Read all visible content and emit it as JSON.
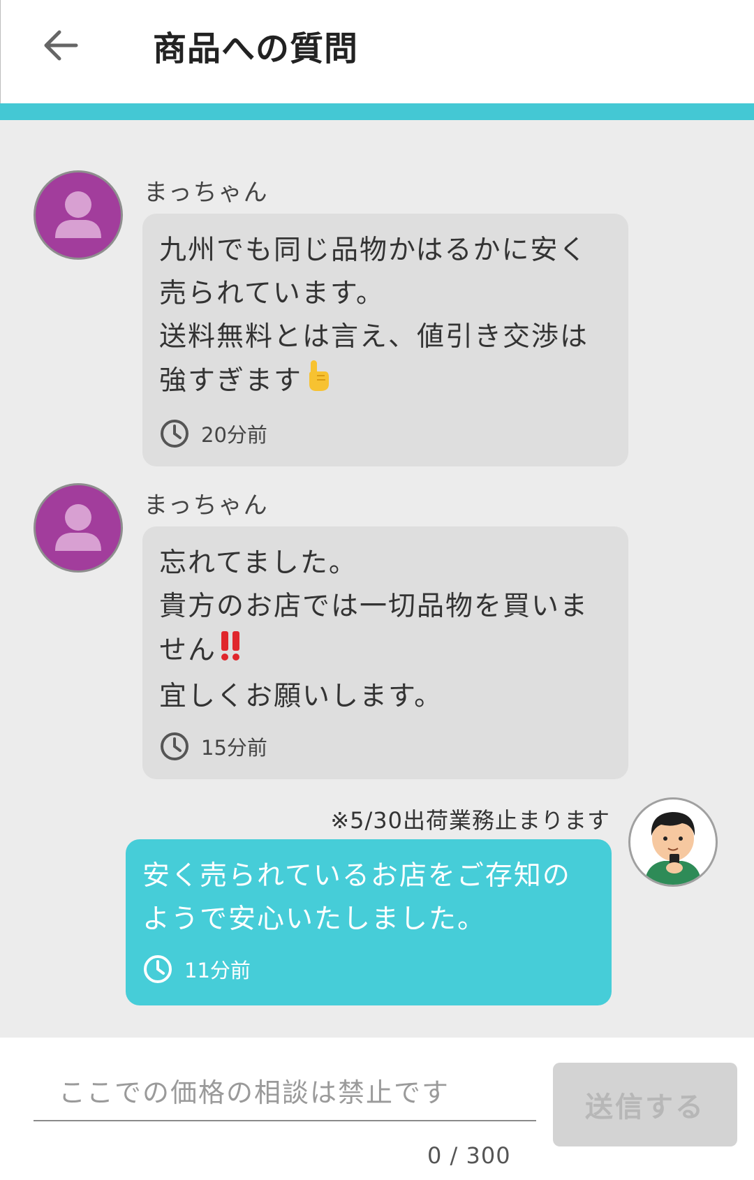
{
  "header": {
    "title": "商品への質問",
    "back_icon": "arrow-left-icon"
  },
  "colors": {
    "accent": "#44c8d4",
    "my_bubble": "#46cdd8",
    "other_bubble": "#dedede",
    "avatar_purple": "#a23d9c"
  },
  "messages": [
    {
      "sender": "まっちゃん",
      "lines": [
        "九州でも同じ品物かはるかに安く",
        "売られています。",
        "送料無料とは言え、値引き交渉は",
        "強すぎます"
      ],
      "emoji": "pointing-up-icon",
      "time": "20分前"
    },
    {
      "sender": "まっちゃん",
      "lines": [
        "忘れてました。",
        "貴方のお店では一切品物を買いま",
        "せん",
        "宜しくお願いします。"
      ],
      "emoji": "double-exclamation-icon",
      "time": "15分前"
    },
    {
      "sender": "※5/30出荷業務止まります",
      "lines": [
        "安く売られているお店をご存知の",
        "ようで安心いたしました。"
      ],
      "time": "11分前"
    }
  ],
  "composer": {
    "placeholder": "ここでの価格の相談は禁止です",
    "value": "",
    "counter": "0 / 300",
    "send_label": "送信する"
  }
}
